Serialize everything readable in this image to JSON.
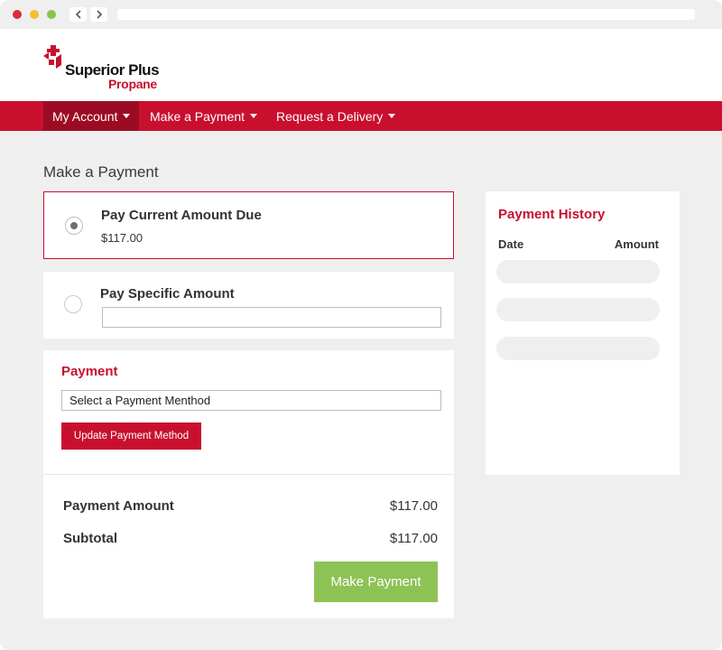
{
  "brand": {
    "name": "Superior Plus",
    "subname": "Propane",
    "accent_color": "#c8102e",
    "logo_icon": "superior-plus-mark-icon"
  },
  "nav": {
    "items": [
      {
        "label": "My Account",
        "active": true
      },
      {
        "label": "Make a Payment",
        "active": false
      },
      {
        "label": "Request a Delivery",
        "active": false
      }
    ]
  },
  "page": {
    "title": "Make a Payment"
  },
  "payment_options": {
    "current_due": {
      "label": "Pay Current Amount Due",
      "amount": "$117.00",
      "selected": true
    },
    "specific": {
      "label": "Pay Specific Amount",
      "value": "",
      "selected": false
    }
  },
  "payment": {
    "heading": "Payment",
    "method_select_value": "Select a Payment Menthod",
    "update_button": "Update Payment Method",
    "summary": {
      "amount_label": "Payment Amount",
      "amount_value": "$117.00",
      "subtotal_label": "Subtotal",
      "subtotal_value": "$117.00"
    },
    "submit_button": "Make Payment",
    "submit_color": "#8dc254"
  },
  "history": {
    "title": "Payment History",
    "col_date": "Date",
    "col_amount": "Amount",
    "placeholder_rows": 3
  }
}
